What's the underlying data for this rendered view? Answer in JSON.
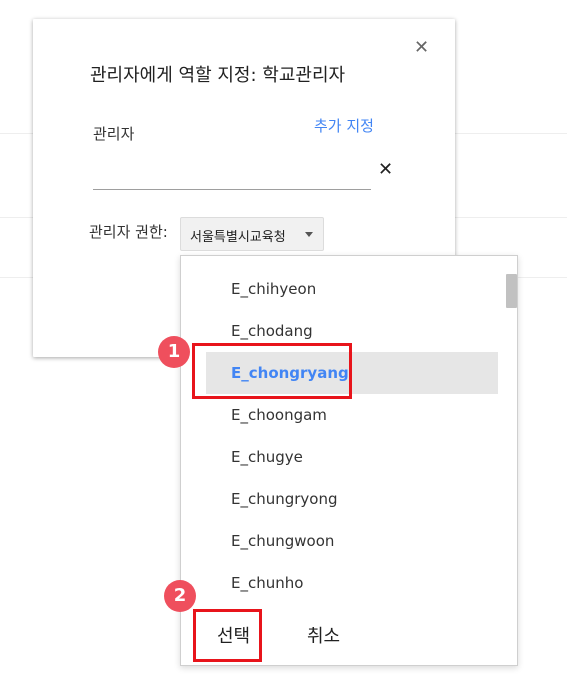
{
  "dialog": {
    "title": "관리자에게 역할 지정: 학교관리자",
    "close_symbol": "✕",
    "admin_label": "관리자",
    "add_link": "추가 지정",
    "admin_input_value": "",
    "clear_symbol": "✕",
    "permission_label": "관리자 권한:",
    "permission_value": "서울특별시교육청"
  },
  "dropdown": {
    "options": [
      "E_chihyeon",
      "E_chodang",
      "E_chongryang",
      "E_choongam",
      "E_chugye",
      "E_chungryong",
      "E_chungwoon",
      "E_chunho"
    ],
    "selected_index": 2,
    "select_button": "선택",
    "cancel_button": "취소"
  },
  "annotations": {
    "badge_1": "1",
    "badge_2": "2",
    "highlight_color": "#e8141b",
    "badge_color": "#ef4f5d"
  }
}
